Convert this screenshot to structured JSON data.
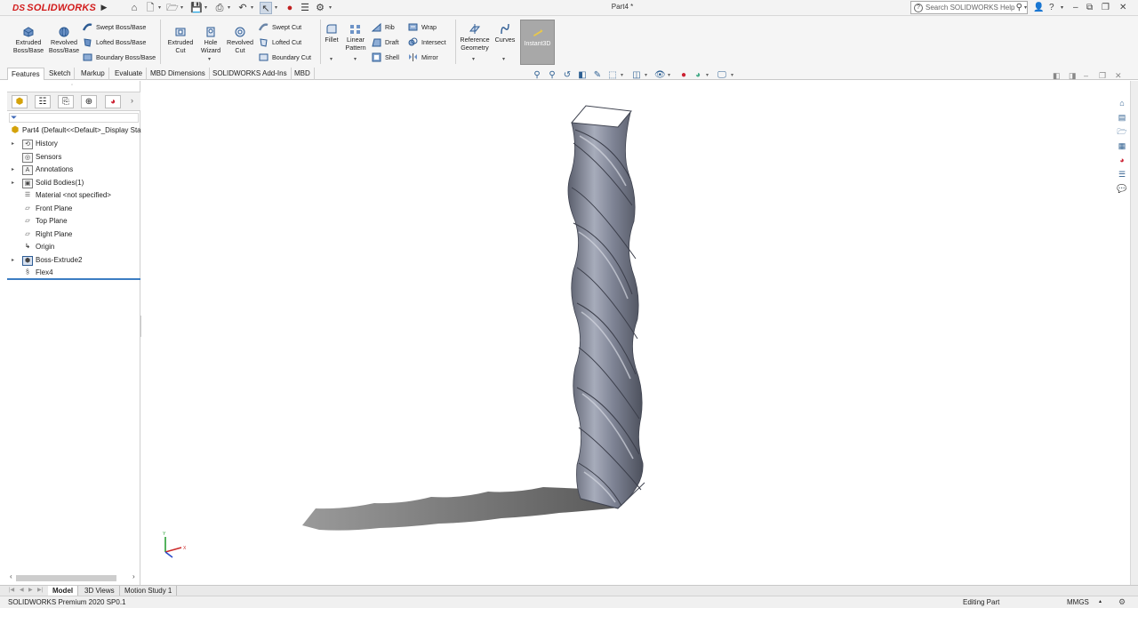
{
  "app": {
    "logo_text": "SOLIDWORKS",
    "logo_prefix": "DS",
    "document_title": "Part4 *",
    "search_placeholder": "Search SOLIDWORKS Help"
  },
  "ribbon": {
    "extruded_boss": "Extruded\nBoss/Base",
    "revolved_boss": "Revolved\nBoss/Base",
    "swept_boss": "Swept Boss/Base",
    "lofted_boss": "Lofted Boss/Base",
    "boundary_boss": "Boundary Boss/Base",
    "extruded_cut": "Extruded\nCut",
    "hole_wizard": "Hole\nWizard",
    "revolved_cut": "Revolved\nCut",
    "swept_cut": "Swept Cut",
    "lofted_cut": "Lofted Cut",
    "boundary_cut": "Boundary Cut",
    "fillet": "Fillet",
    "linear_pattern": "Linear\nPattern",
    "rib": "Rib",
    "draft": "Draft",
    "shell": "Shell",
    "wrap": "Wrap",
    "intersect": "Intersect",
    "mirror": "Mirror",
    "reference_geometry": "Reference\nGeometry",
    "curves": "Curves",
    "instant3d": "Instant3D"
  },
  "command_tabs": [
    "Features",
    "Sketch",
    "Markup",
    "Evaluate",
    "MBD Dimensions",
    "SOLIDWORKS Add-Ins",
    "MBD"
  ],
  "feature_tree": {
    "root": "Part4  (Default<<Default>_Display Sta",
    "items": [
      {
        "label": "History",
        "expandable": true,
        "icon": "history-icon"
      },
      {
        "label": "Sensors",
        "expandable": false,
        "icon": "sensor-icon"
      },
      {
        "label": "Annotations",
        "expandable": true,
        "icon": "annotation-icon"
      },
      {
        "label": "Solid Bodies(1)",
        "expandable": true,
        "icon": "solid-bodies-icon"
      },
      {
        "label": "Material <not specified>",
        "expandable": false,
        "icon": "material-icon"
      },
      {
        "label": "Front Plane",
        "expandable": false,
        "icon": "plane-icon"
      },
      {
        "label": "Top Plane",
        "expandable": false,
        "icon": "plane-icon"
      },
      {
        "label": "Right Plane",
        "expandable": false,
        "icon": "plane-icon"
      },
      {
        "label": "Origin",
        "expandable": false,
        "icon": "origin-icon"
      },
      {
        "label": "Boss-Extrude2",
        "expandable": true,
        "icon": "extrude-icon"
      },
      {
        "label": "Flex4",
        "expandable": false,
        "icon": "flex-icon"
      }
    ]
  },
  "triad": {
    "x_label": "X",
    "y_label": "Y"
  },
  "bottom_tabs": [
    "Model",
    "3D Views",
    "Motion Study 1"
  ],
  "status": {
    "product": "SOLIDWORKS Premium 2020 SP0.1",
    "mode": "Editing Part",
    "units": "MMGS"
  },
  "colors": {
    "brand_red": "#d21b1b",
    "selection_blue": "#3c7dc2",
    "instant3d_active": "#a8a8a8",
    "model_gray": "#8f94a3"
  }
}
